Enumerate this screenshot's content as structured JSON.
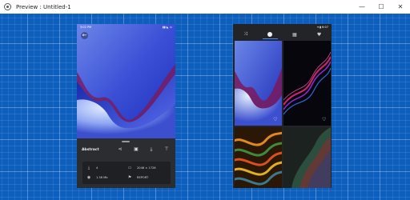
{
  "window": {
    "title": "Preview : Untitled-1",
    "minimize": "—",
    "maximize": "☐",
    "close": "✕"
  },
  "phone1": {
    "status": {
      "left": "3:02 PM",
      "right": "▮▮ ◣ ▭"
    },
    "wallpaper_name": "Abstract",
    "info": {
      "downloads": "4",
      "size": "1.36 Mb",
      "resolution": "2048 × 1726",
      "report": "REPORT"
    },
    "icons": {
      "back": "back-arrow-icon",
      "share": "share-icon",
      "set": "set-wallpaper-icon",
      "download": "download-icon",
      "paint": "paint-roller-icon"
    }
  },
  "phone2": {
    "status": {
      "right": "▾ ▮ 6:07"
    },
    "tabs": [
      "shuffle-icon",
      "explore-icon",
      "grid-icon",
      "favorite-icon"
    ]
  },
  "colors": {
    "canvas": "#0d5fbd",
    "phone_bg": "#1e2024",
    "accent": "#3d8bff"
  }
}
